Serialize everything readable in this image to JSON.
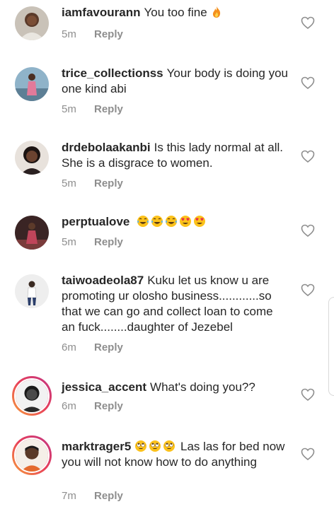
{
  "comments": [
    {
      "username": "iamfavourann",
      "text": "You too fine",
      "emoji": [
        "fire-emoji"
      ],
      "time": "5m",
      "reply": "Reply"
    },
    {
      "username": "trice_collectionss",
      "text": "Your body is doing you one kind abi",
      "time": "5m",
      "reply": "Reply"
    },
    {
      "username": "drdebolaakanbi",
      "text": "Is this lady normal at all. She is a disgrace to women.",
      "time": "5m",
      "reply": "Reply"
    },
    {
      "username": "perptualove",
      "text": "",
      "emoji": [
        "tears-of-joy-emoji",
        "tears-of-joy-emoji",
        "tears-of-joy-emoji",
        "heart-eyes-emoji",
        "heart-eyes-emoji"
      ],
      "time": "5m",
      "reply": "Reply"
    },
    {
      "username": "taiwoadeola87",
      "text": "Kuku let us know u are promoting ur olosho business............so that we can go and collect loan to come an fuck........daughter of Jezebel",
      "time": "6m",
      "reply": "Reply"
    },
    {
      "username": "jessica_accent",
      "text": "What's doing you??",
      "time": "6m",
      "reply": "Reply"
    },
    {
      "username": "marktrager5",
      "text": "Las las for bed now you will not know how to do anything",
      "emoji_before": [
        "eye-roll-emoji",
        "eye-roll-emoji",
        "eye-roll-emoji"
      ],
      "time": "7m",
      "reply": "Reply"
    }
  ],
  "icons": {
    "like": "heart-outline-icon"
  },
  "colors": {
    "text": "#262626",
    "meta": "#8e8e8e",
    "story_ring_start": "#f7a13a",
    "story_ring_end": "#c13584"
  }
}
